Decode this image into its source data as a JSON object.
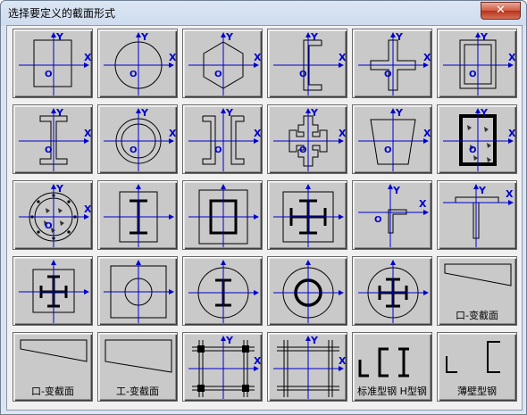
{
  "window": {
    "title": "选择要定义的截面形式",
    "close_label": "✕"
  },
  "axis": {
    "x": "X",
    "y": "Y",
    "o": "O"
  },
  "tiles": [
    {
      "shape": "solid-rect"
    },
    {
      "shape": "solid-circle"
    },
    {
      "shape": "hexagon"
    },
    {
      "shape": "channel"
    },
    {
      "shape": "cross"
    },
    {
      "shape": "hollow-rect"
    },
    {
      "shape": "i-beam"
    },
    {
      "shape": "hollow-circle"
    },
    {
      "shape": "double-channel"
    },
    {
      "shape": "multi-cross"
    },
    {
      "shape": "trapezoid"
    },
    {
      "shape": "reinforced-rect"
    },
    {
      "shape": "reinforced-circle"
    },
    {
      "shape": "steel-i-in-box"
    },
    {
      "shape": "steel-box-in-box"
    },
    {
      "shape": "steel-cross-in-box"
    },
    {
      "shape": "angle"
    },
    {
      "shape": "tee"
    },
    {
      "shape": "steel-cross-small"
    },
    {
      "shape": "circle-in-box"
    },
    {
      "shape": "i-in-circle"
    },
    {
      "shape": "ring-in-circle"
    },
    {
      "shape": "cross-in-circle"
    },
    {
      "shape": "tapered-box",
      "label": "口-变截面"
    },
    {
      "shape": "tapered-box",
      "label": "口-变截面"
    },
    {
      "shape": "tapered-i",
      "label": "工-变截面"
    },
    {
      "shape": "lattice-a"
    },
    {
      "shape": "lattice-b"
    },
    {
      "shape": "std-steel",
      "label": "标准型钢 H型钢"
    },
    {
      "shape": "thin-steel",
      "label": "薄壁型钢"
    }
  ]
}
